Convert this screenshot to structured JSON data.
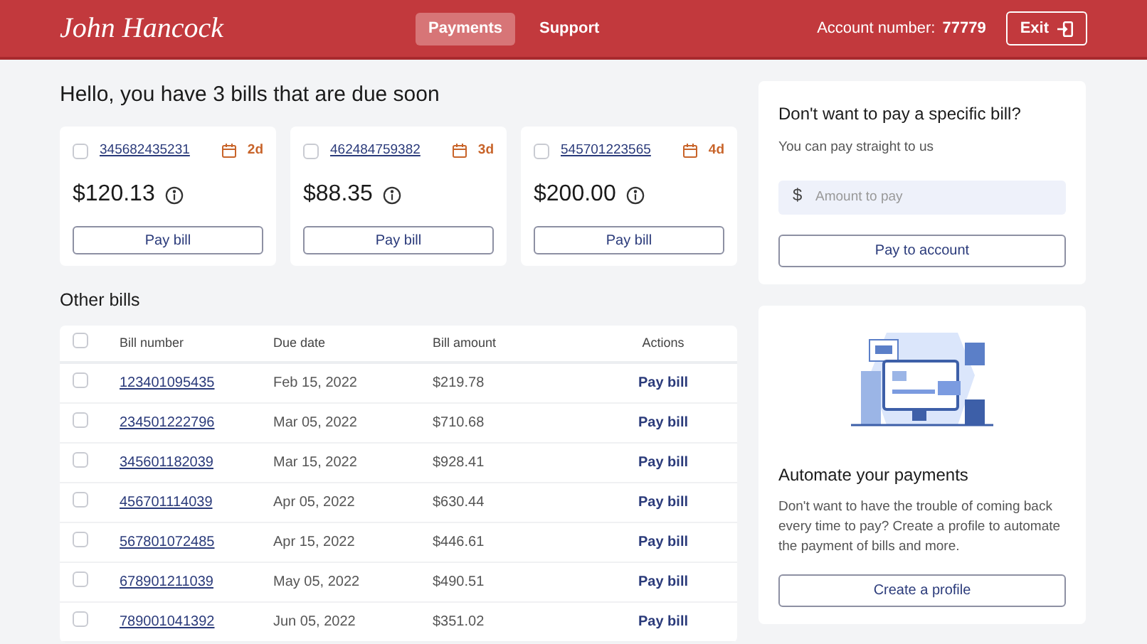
{
  "header": {
    "logo": "John Hancock",
    "nav": [
      {
        "label": "Payments",
        "selected": true
      },
      {
        "label": "Support",
        "selected": false
      }
    ],
    "account_label": "Account number:",
    "account_number": "77779",
    "exit_button": "Exit"
  },
  "greeting": "Hello, you have 3 bills that are due soon",
  "due_bills": [
    {
      "number": "345682435231",
      "checked": false,
      "due": "2d",
      "amount": "$120.13",
      "button": "Pay bill"
    },
    {
      "number": "462484759382",
      "checked": false,
      "due": "3d",
      "amount": "$88.35",
      "button": "Pay bill"
    },
    {
      "number": "545701223565",
      "checked": false,
      "due": "4d",
      "amount": "$200.00",
      "button": "Pay bill"
    }
  ],
  "other_bills": {
    "title": "Other bills",
    "select_all": false,
    "columns": [
      "Bill number",
      "Due date",
      "Bill amount",
      "Actions"
    ],
    "rows": [
      {
        "number": "123401095435",
        "due": "Feb 15, 2022",
        "amount": "$219.78",
        "action": "Pay bill",
        "checked": false
      },
      {
        "number": "234501222796",
        "due": "Mar 05, 2022",
        "amount": "$710.68",
        "action": "Pay bill",
        "checked": false
      },
      {
        "number": "345601182039",
        "due": "Mar 15, 2022",
        "amount": "$928.41",
        "action": "Pay bill",
        "checked": false
      },
      {
        "number": "456701114039",
        "due": "Apr 05, 2022",
        "amount": "$630.44",
        "action": "Pay bill",
        "checked": false
      },
      {
        "number": "567801072485",
        "due": "Apr 15, 2022",
        "amount": "$446.61",
        "action": "Pay bill",
        "checked": false
      },
      {
        "number": "678901211039",
        "due": "May 05, 2022",
        "amount": "$490.51",
        "action": "Pay bill",
        "checked": false
      },
      {
        "number": "789001041392",
        "due": "Jun 05, 2022",
        "amount": "$351.02",
        "action": "Pay bill",
        "checked": false
      }
    ]
  },
  "pay_account": {
    "title": "Don't want to pay a specific bill?",
    "subtitle": "You can pay straight to us",
    "currency": "$",
    "placeholder": "Amount to pay",
    "button": "Pay to account"
  },
  "automate": {
    "title": "Automate your payments",
    "text": "Don't want to have the trouble of coming back every time to pay? Create a profile to automate the payment of bills and more.",
    "button": "Create a profile"
  }
}
